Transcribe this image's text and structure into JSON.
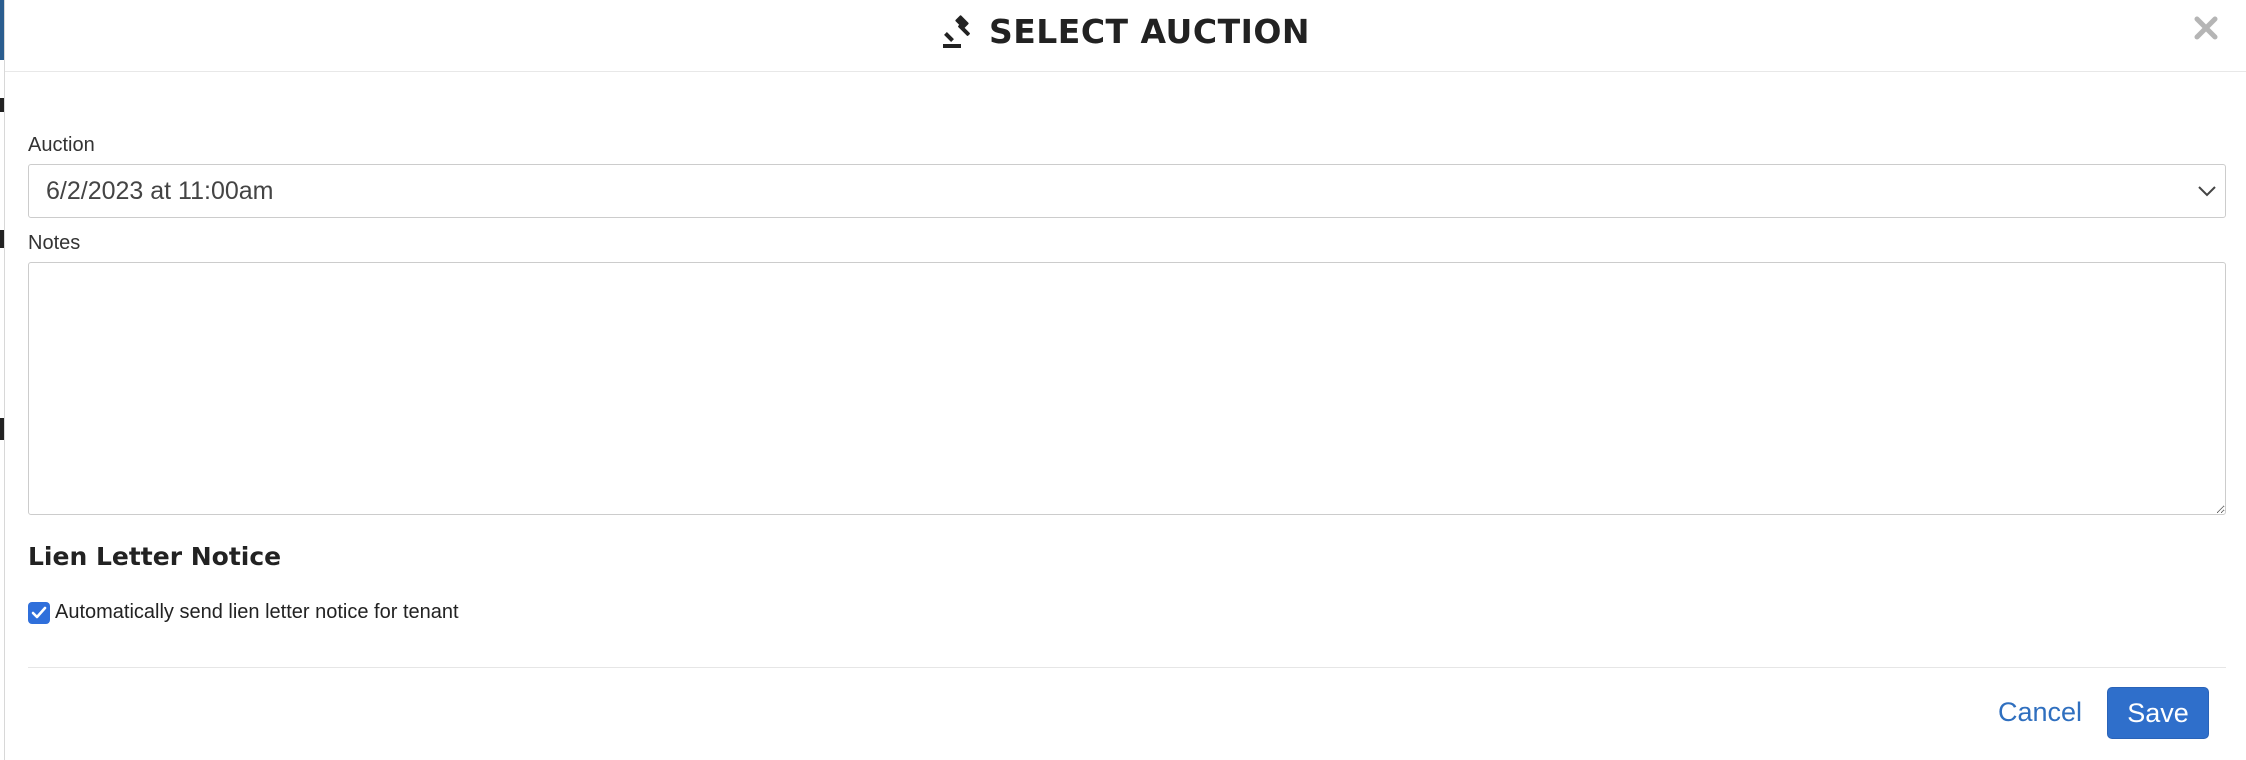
{
  "modal": {
    "title": "SELECT AUCTION",
    "title_icon": "gavel-icon",
    "close_icon": "close-icon"
  },
  "form": {
    "auction_label": "Auction",
    "auction_selected": "6/2/2023 at 11:00am",
    "notes_label": "Notes",
    "notes_value": ""
  },
  "lien": {
    "section_title": "Lien Letter Notice",
    "auto_send_label": "Automatically send lien letter notice for tenant",
    "auto_send_checked": true
  },
  "footer": {
    "cancel_label": "Cancel",
    "save_label": "Save"
  },
  "colors": {
    "primary": "#2f6fcb",
    "link": "#2f6fbf",
    "checkbox": "#2f6fdb"
  }
}
